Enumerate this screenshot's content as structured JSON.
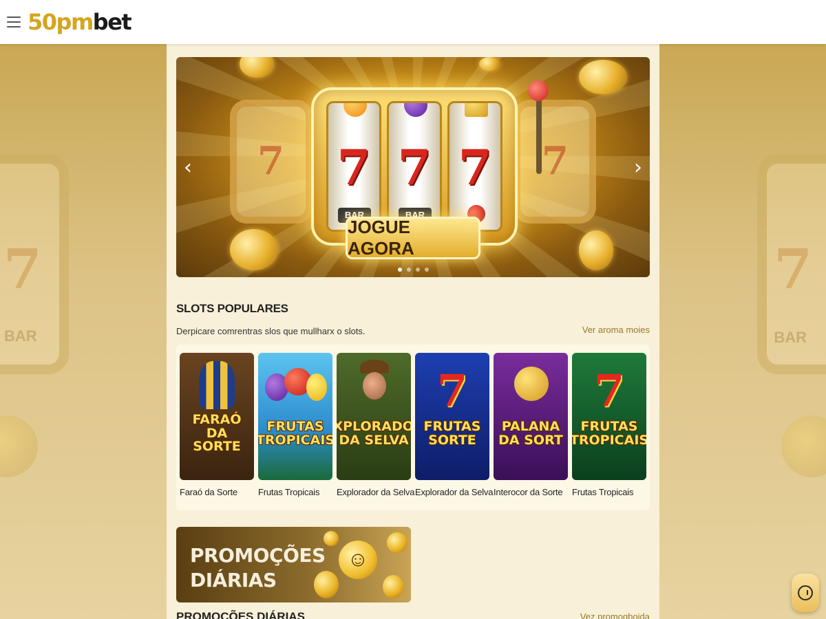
{
  "header": {
    "logo_part1": "50pm",
    "logo_part2": "bet"
  },
  "banner": {
    "cta_label": "JOGUE AGORA",
    "prev_arrow": "‹",
    "next_arrow": "›",
    "slide_count": 4,
    "active_slide": 1,
    "reel_symbols": [
      "7",
      "7",
      "7"
    ],
    "reel_bars": [
      "BAR",
      "BAR"
    ]
  },
  "popular_slots": {
    "title": "SLOTS POPULARES",
    "subtitle": "Derpicare comrentras slos que mullharx o slots.",
    "see_more": "Ver aroma moies",
    "games": [
      {
        "thumb_title": "FARAÓ DA SORTE",
        "name": "Faraó da Sorte"
      },
      {
        "thumb_title": "FRUTAS TROPICAIS",
        "name": "Frutas Tropicais"
      },
      {
        "thumb_title": "EXPLORADOR DA SELVA",
        "name": "Explorador da Selva"
      },
      {
        "thumb_title": "FRUTAS SORTE",
        "name": "Explorador da Selva"
      },
      {
        "thumb_title": "PALANA DA SORT",
        "name": "Interocor da Sorte"
      },
      {
        "thumb_title": "FRUTAS TROPICAIS",
        "name": "Frutas Tropicais"
      }
    ]
  },
  "promo_banner": {
    "line1": "PROMOÇÕES",
    "line2": "DIÁRIAS"
  },
  "daily_promos": {
    "title": "PROMOÇÕES DIÁRIAS",
    "see_more": "Vez promogboida"
  },
  "colors": {
    "brand_gold": "#d4a51e",
    "brand_dark": "#1b1b1b",
    "link_gold": "#9a7a2a"
  }
}
